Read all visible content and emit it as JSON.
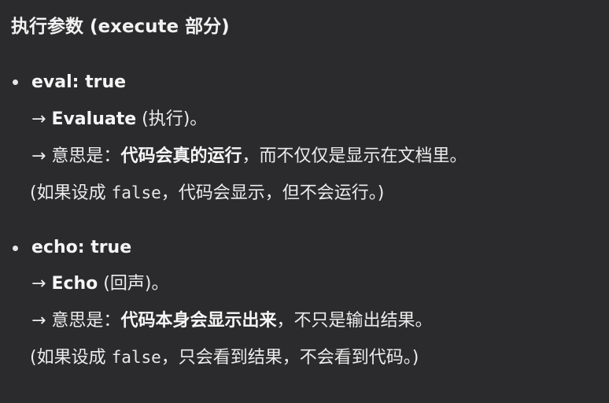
{
  "title": "执行参数 (execute 部分)",
  "items": [
    {
      "key": "eval: true",
      "translation": {
        "arrow": "→",
        "bold": "Evaluate",
        "rest": " (执行)。"
      },
      "meaning": {
        "arrow": "→",
        "label": " 意思是：",
        "bold": "代码会真的运行",
        "rest": "，而不仅仅是显示在文档里。"
      },
      "note": {
        "prefix": "(如果设成 ",
        "code": "false",
        "suffix": "，代码会显示，但不会运行。)"
      }
    },
    {
      "key": "echo: true",
      "translation": {
        "arrow": "→",
        "bold": "Echo",
        "rest": " (回声)。"
      },
      "meaning": {
        "arrow": "→",
        "label": " 意思是：",
        "bold": "代码本身会显示出来",
        "rest": "，不只是输出结果。"
      },
      "note": {
        "prefix": "(如果设成 ",
        "code": "false",
        "suffix": "，只会看到结果，不会看到代码。)"
      }
    }
  ]
}
